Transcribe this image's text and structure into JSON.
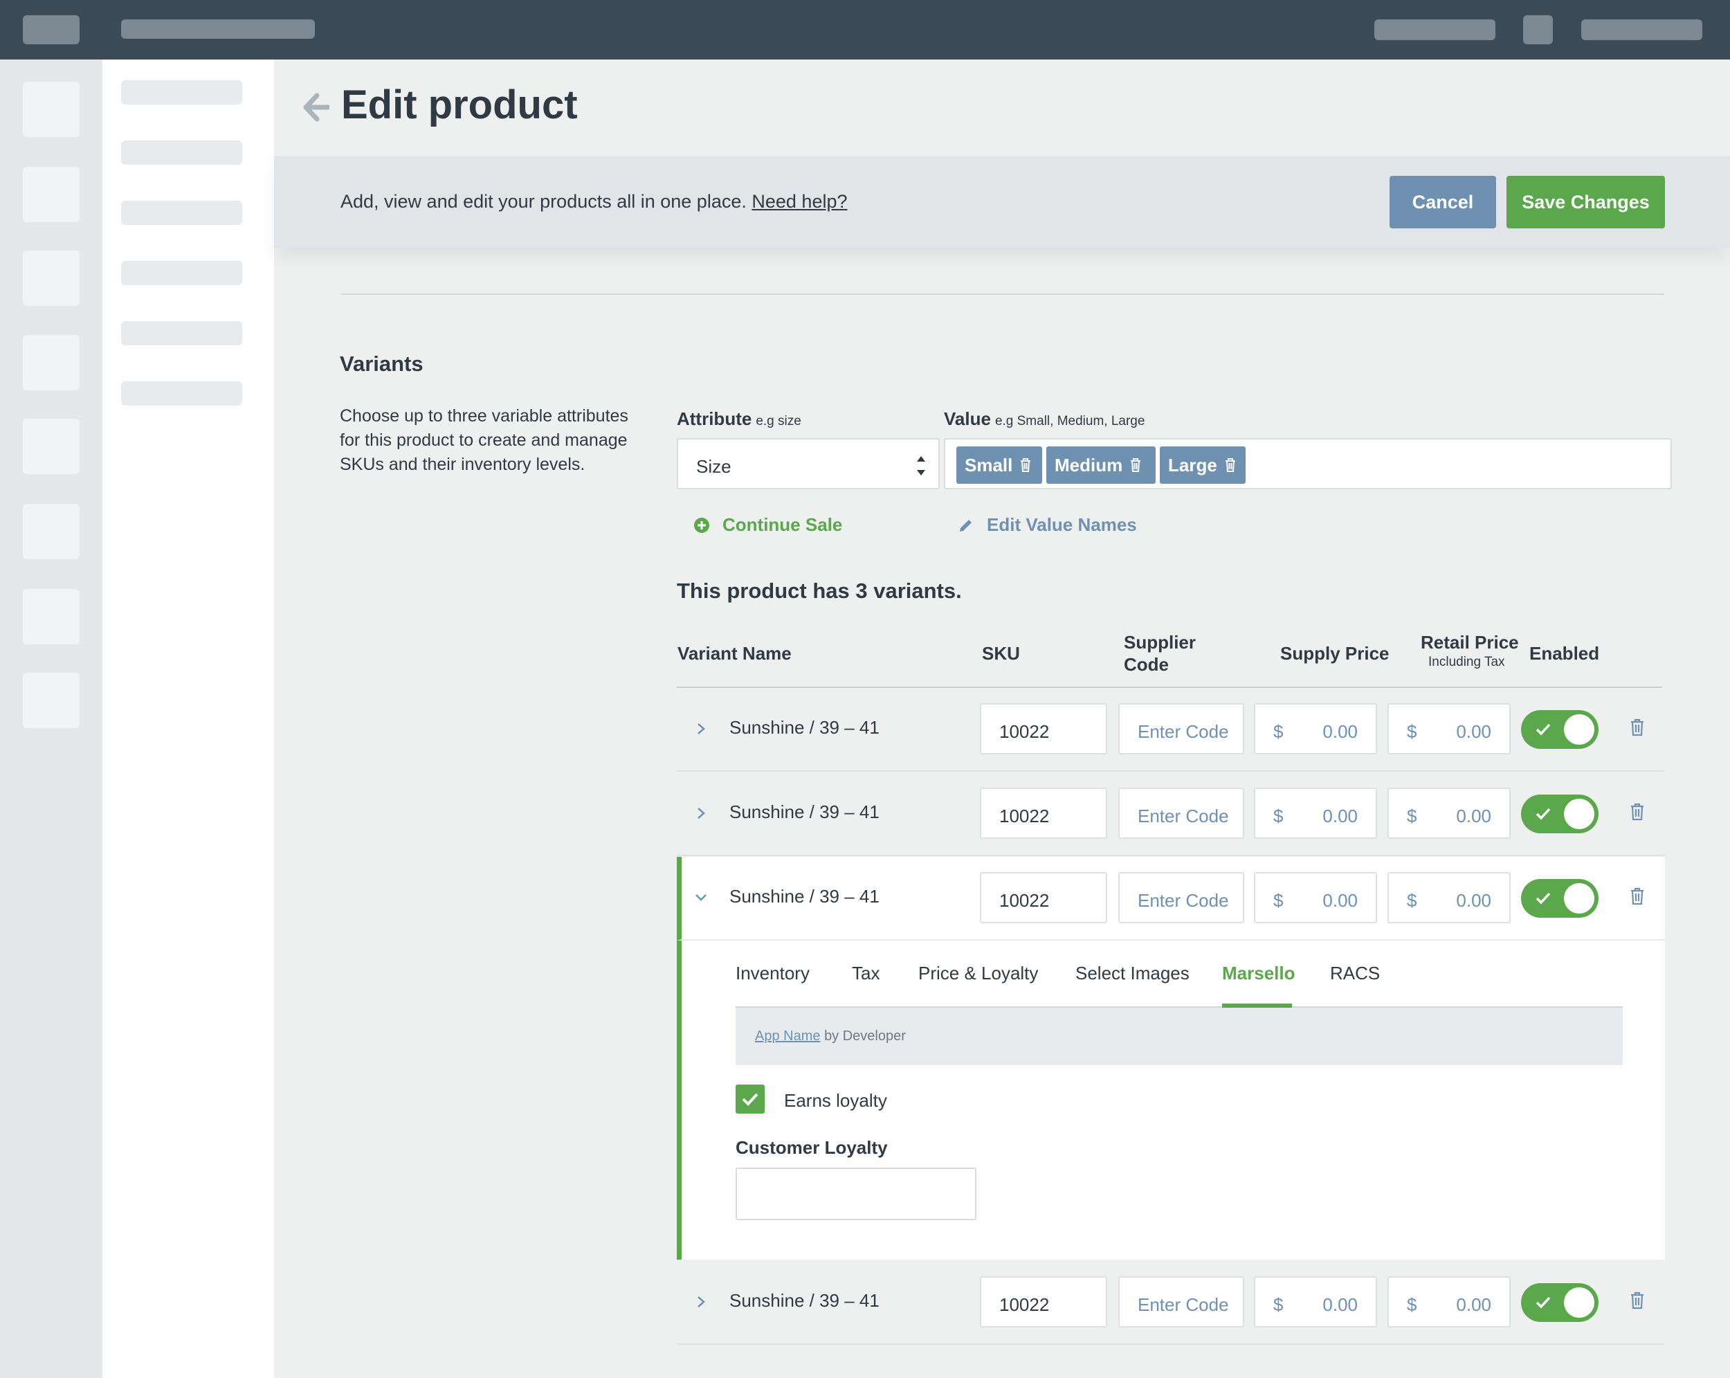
{
  "header": {
    "title": "Edit product",
    "info_text": "Add, view and edit your products all in one place.",
    "help_link": "Need help?",
    "cancel_label": "Cancel",
    "save_label": "Save Changes"
  },
  "variants_section": {
    "title": "Variants",
    "description": "Choose up to three variable attributes for this product to create and manage SKUs and their inventory levels.",
    "attribute_label": "Attribute",
    "attribute_hint": "e.g size",
    "attribute_value": "Size",
    "value_label": "Value",
    "value_hint": "e.g Small, Medium, Large",
    "values": [
      "Small",
      "Medium",
      "Large"
    ],
    "continue_sale_label": "Continue Sale",
    "edit_value_names_label": "Edit Value Names",
    "variant_count_text": "This product has 3 variants."
  },
  "table": {
    "headers": {
      "variant_name": "Variant Name",
      "sku": "SKU",
      "supplier_code_line1": "Supplier",
      "supplier_code_line2": "Code",
      "supply_price": "Supply Price",
      "retail_price": "Retail Price",
      "retail_price_sub": "Including Tax",
      "enabled": "Enabled"
    },
    "rows": [
      {
        "name": "Sunshine / 39 – 41",
        "sku": "10022",
        "supplier_code_placeholder": "Enter Code",
        "supply_currency": "$",
        "supply_price": "0.00",
        "retail_currency": "$",
        "retail_price": "0.00",
        "enabled": true
      },
      {
        "name": "Sunshine / 39 – 41",
        "sku": "10022",
        "supplier_code_placeholder": "Enter Code",
        "supply_currency": "$",
        "supply_price": "0.00",
        "retail_currency": "$",
        "retail_price": "0.00",
        "enabled": true
      },
      {
        "name": "Sunshine / 39 – 41",
        "sku": "10022",
        "supplier_code_placeholder": "Enter Code",
        "supply_currency": "$",
        "supply_price": "0.00",
        "retail_currency": "$",
        "retail_price": "0.00",
        "enabled": true
      },
      {
        "name": "Sunshine / 39 – 41",
        "sku": "10022",
        "supplier_code_placeholder": "Enter Code",
        "supply_currency": "$",
        "supply_price": "0.00",
        "retail_currency": "$",
        "retail_price": "0.00",
        "enabled": true
      }
    ]
  },
  "expanded_panel": {
    "tabs": [
      "Inventory",
      "Tax",
      "Price & Loyalty",
      "Select Images",
      "Marsello",
      "RACS"
    ],
    "active_tab": "Marsello",
    "app_name_link": "App Name",
    "app_by_text": "by Developer",
    "earns_loyalty_label": "Earns loyalty",
    "earns_loyalty_checked": true,
    "customer_loyalty_label": "Customer Loyalty",
    "customer_loyalty_value": ""
  },
  "colors": {
    "topbar": "#3b4a55",
    "accent_green": "#5aa84b",
    "accent_blue": "#6f91b1",
    "text_dark": "#2f3a44"
  },
  "icons": {
    "back": "arrow-left-icon",
    "chip_delete": "trash-icon",
    "continue_sale": "plus-circle-icon",
    "edit_values": "pencil-icon",
    "row_collapsed": "chevron-right-icon",
    "row_expanded": "chevron-down-icon",
    "toggle_check": "check-icon",
    "row_delete": "trash-icon"
  }
}
